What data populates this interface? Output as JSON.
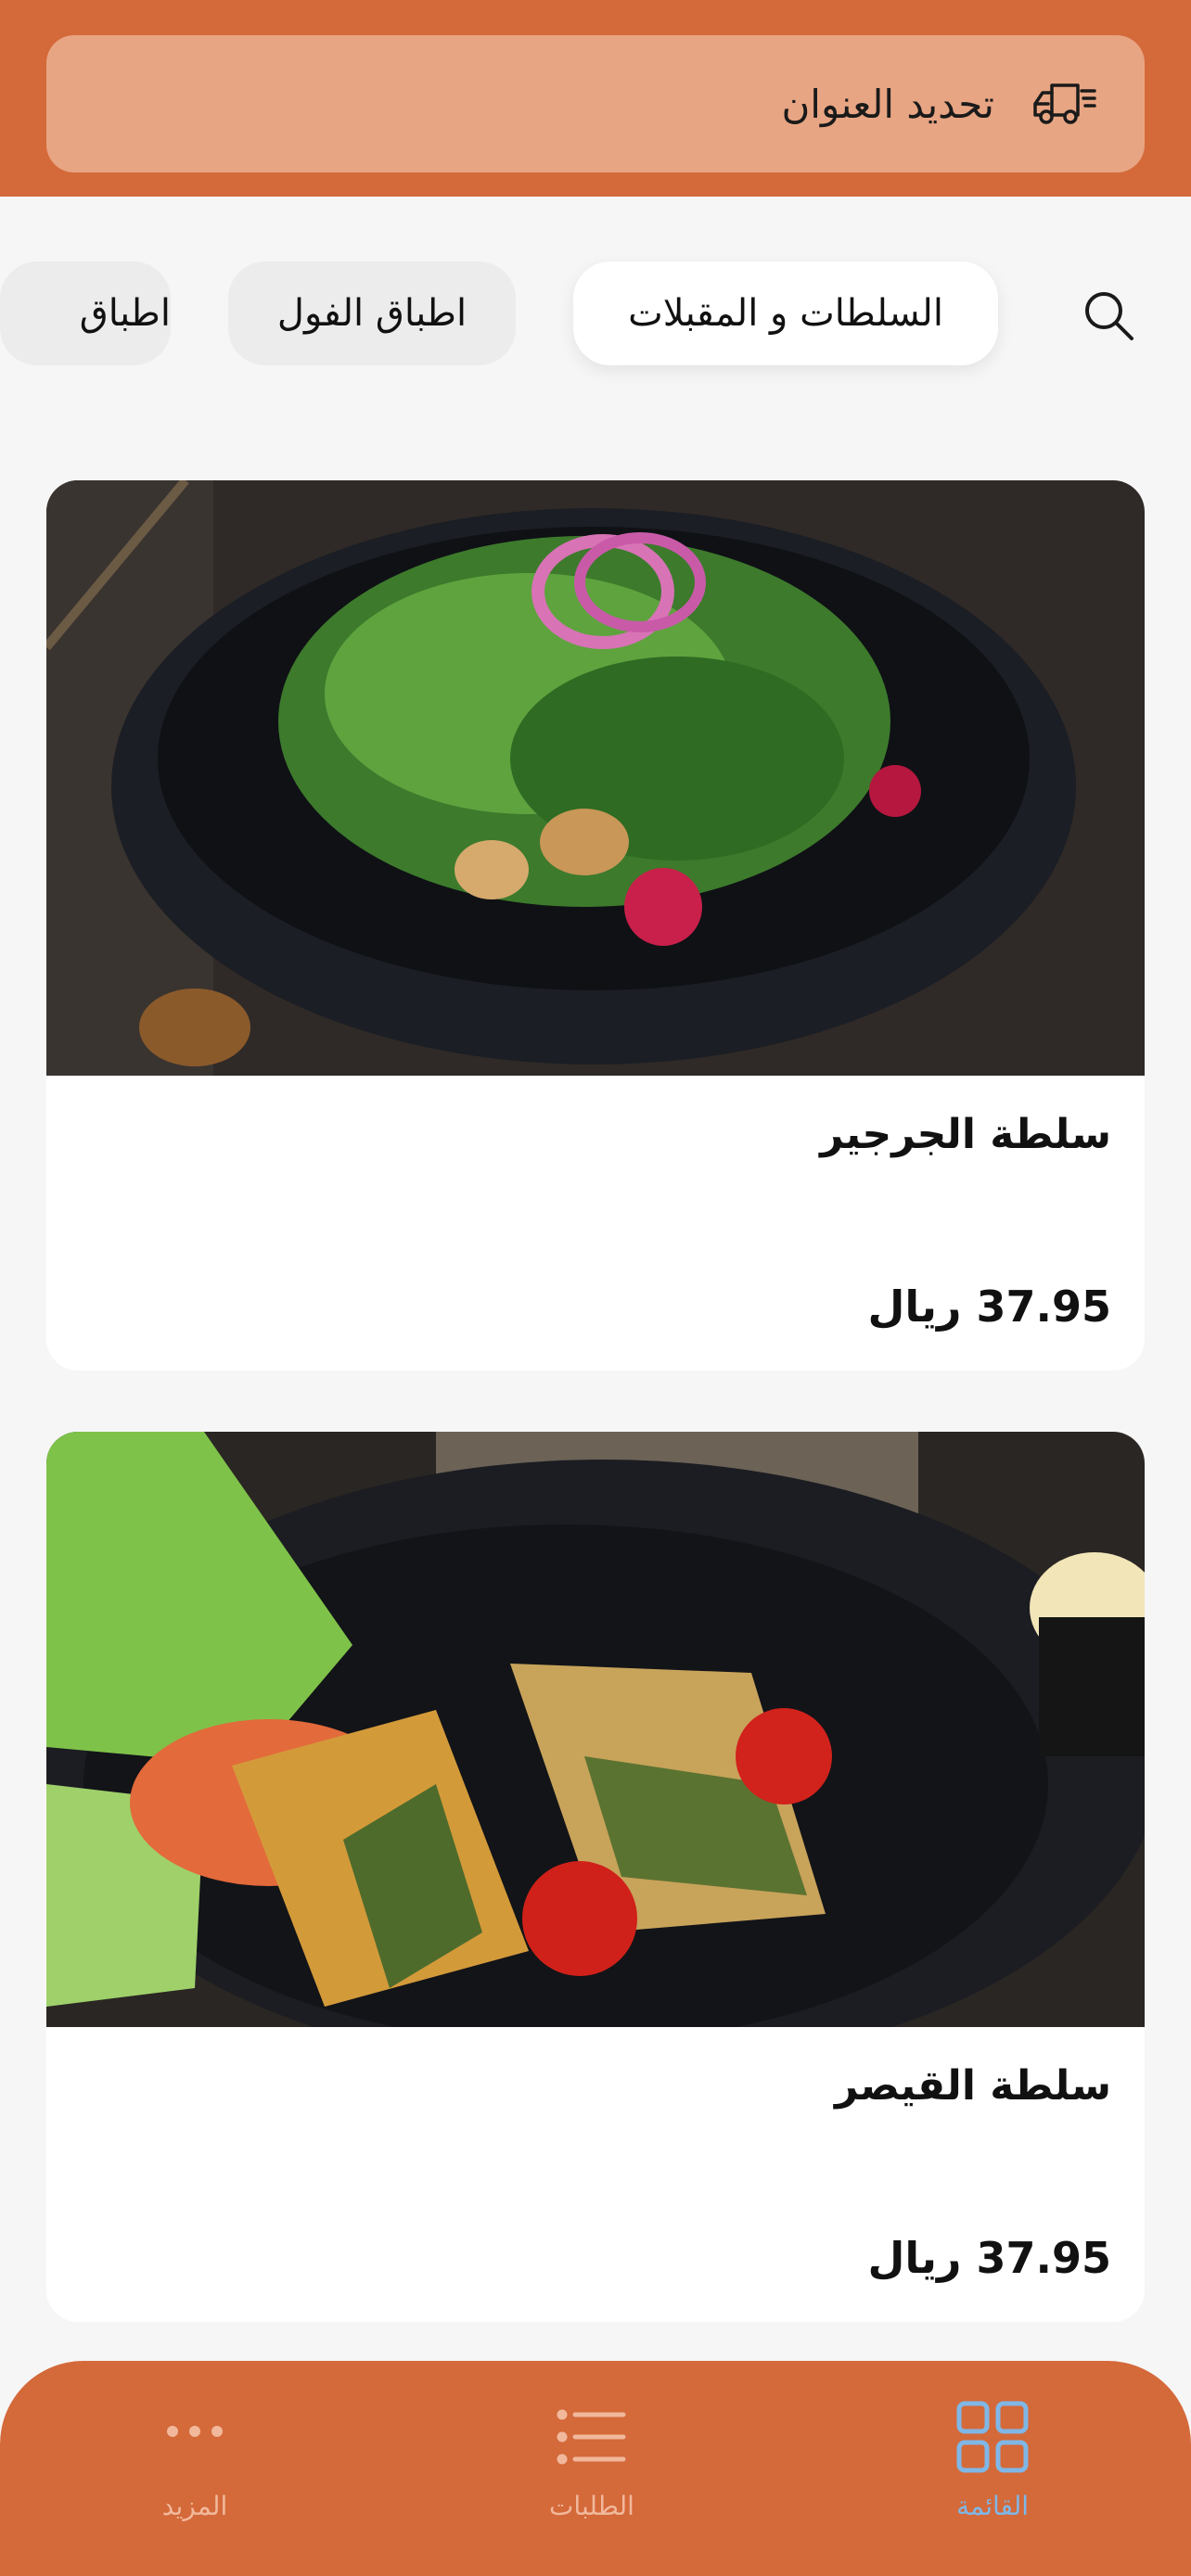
{
  "address_bar": {
    "label": "تحديد العنوان",
    "icon": "delivery-truck-icon"
  },
  "categories": {
    "search_icon": "search-icon",
    "items": [
      {
        "label": "السلطات و المقبلات",
        "active": true
      },
      {
        "label": "اطباق الفول",
        "active": false
      },
      {
        "label": "اطباق",
        "active": false
      }
    ]
  },
  "products": [
    {
      "name": "سلطة الجرجير",
      "price": "37.95 ريال"
    },
    {
      "name": "سلطة القيصر",
      "price": "37.95 ريال"
    }
  ],
  "bottom_nav": {
    "items": [
      {
        "label": "القائمة",
        "icon": "grid-icon",
        "active": true
      },
      {
        "label": "الطلبات",
        "icon": "list-icon",
        "active": false
      },
      {
        "label": "المزيد",
        "icon": "more-dots-icon",
        "active": false
      }
    ]
  },
  "colors": {
    "brand": "#d4693a",
    "address_bg": "#e8a583",
    "active_nav": "#7fb7e6"
  }
}
